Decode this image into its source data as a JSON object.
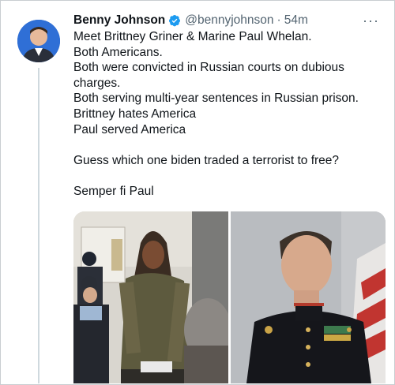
{
  "tweet": {
    "author_name": "Benny Johnson",
    "handle": "@bennyjohnson",
    "separator": "·",
    "time": "54m",
    "more_label": "···",
    "lines": [
      "Meet Brittney Griner & Marine Paul Whelan.",
      "Both Americans.",
      "Both were convicted in Russian courts on dubious",
      "charges.",
      "Both serving multi-year sentences in Russian prison.",
      "Brittney hates America",
      "Paul served America",
      "",
      "Guess which one biden traded a terrorist to free?",
      "",
      "Semper fi Paul"
    ]
  },
  "icons": {
    "verified": "verified-badge-icon",
    "more": "more-options-icon"
  },
  "colors": {
    "verified_blue": "#1d9bf0",
    "secondary_text": "#536471",
    "primary_text": "#0f1419"
  }
}
